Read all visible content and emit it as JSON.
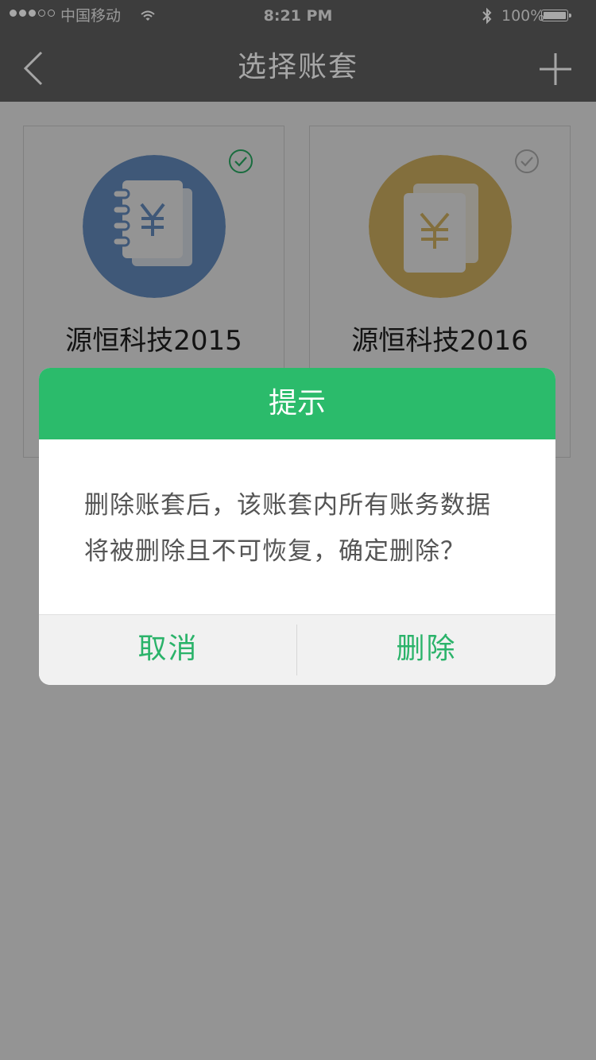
{
  "status_bar": {
    "carrier": "中国移动",
    "time": "8:21 PM",
    "battery_percent": "100%",
    "signal_bars_filled": 3,
    "signal_bars_total": 5,
    "icons": [
      "wifi-icon",
      "bluetooth-icon",
      "battery-icon"
    ]
  },
  "nav": {
    "title": "选择账套",
    "back_icon": "chevron-left-icon",
    "add_icon": "plus-icon"
  },
  "books": [
    {
      "name": "源恒科技2015",
      "selected": true,
      "icon": "ledger-yen-icon",
      "color": "#6d98cf"
    },
    {
      "name": "源恒科技2016",
      "selected": false,
      "icon": "ledger-yen-icon",
      "color": "#e2bf6a"
    }
  ],
  "dialog": {
    "title": "提示",
    "message_line1": "删除账套后，该账套内所有账务数据",
    "message_line2": "将被删除且不可恢复，确定删除？",
    "cancel_label": "取消",
    "delete_label": "删除"
  },
  "colors": {
    "accent": "#2bbb6b",
    "bar_background": "#3d3d3d",
    "overlay": "rgba(0,0,0,0.42)"
  }
}
